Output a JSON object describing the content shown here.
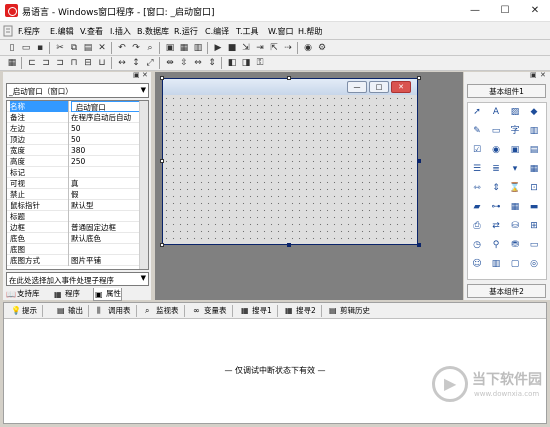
{
  "window": {
    "title": "易语言 - Windows窗口程序 - [窗口: _启动窗口]",
    "min": "—",
    "max": "☐",
    "close": "✕"
  },
  "menu": [
    "F.程序",
    "E.编辑",
    "V.查看",
    "I.插入",
    "B.数据库",
    "R.运行",
    "C.编译",
    "T.工具",
    "W.窗口",
    "H.帮助"
  ],
  "left_panel": {
    "selected_component": "_启动窗口（窗口）",
    "properties": [
      {
        "name": "名称",
        "value": "_启动窗口"
      },
      {
        "name": "备注",
        "value": "在程序启动后自动"
      },
      {
        "name": "左边",
        "value": "50"
      },
      {
        "name": "顶边",
        "value": "50"
      },
      {
        "name": "宽度",
        "value": "380"
      },
      {
        "name": "高度",
        "value": "250"
      },
      {
        "name": "标记",
        "value": ""
      },
      {
        "name": "可视",
        "value": "真"
      },
      {
        "name": "禁止",
        "value": "假"
      },
      {
        "name": "鼠标指针",
        "value": "默认型"
      },
      {
        "name": "标题",
        "value": ""
      },
      {
        "name": "边框",
        "value": "普通固定边框"
      },
      {
        "name": "底色",
        "value": "默认底色"
      },
      {
        "name": "底图",
        "value": ""
      },
      {
        "name": "底图方式",
        "value": "图片平铺"
      }
    ],
    "event_placeholder": "在此处选择加入事件处理子程序",
    "tabs": [
      "支持库",
      "程序",
      "属性"
    ]
  },
  "right_panel": {
    "group1": "基本组件1",
    "group2": "基本组件2",
    "icons": [
      "pointer-icon",
      "label-icon",
      "image-icon",
      "shape-icon",
      "edit-icon",
      "textbox-icon",
      "font-icon",
      "grid-icon",
      "checkbox-icon",
      "radio-icon",
      "button-icon",
      "tab-icon",
      "list-icon",
      "list2-icon",
      "combo-icon",
      "table-icon",
      "hscroll-icon",
      "vscroll-icon",
      "timer-icon",
      "frame-icon",
      "progress-icon",
      "slider-icon",
      "calendar-icon",
      "status-icon",
      "printer-icon",
      "network-icon",
      "database-icon",
      "data-icon",
      "clock-icon",
      "socket-icon",
      "drive-icon",
      "folder-icon",
      "user-icon",
      "server-icon",
      "monitor-icon",
      "media-icon"
    ]
  },
  "bottom_panel": {
    "tabs": [
      "提示",
      "输出",
      "调用表",
      "监视表",
      "变量表",
      "搜寻1",
      "搜寻2",
      "剪辑历史"
    ],
    "message": "— 仅调试中断状态下有效 —"
  },
  "watermark": {
    "brand": "当下软件园",
    "url": "www.downxia.com"
  },
  "colors": {
    "accent": "#3399ff",
    "design_bg": "#808080"
  }
}
